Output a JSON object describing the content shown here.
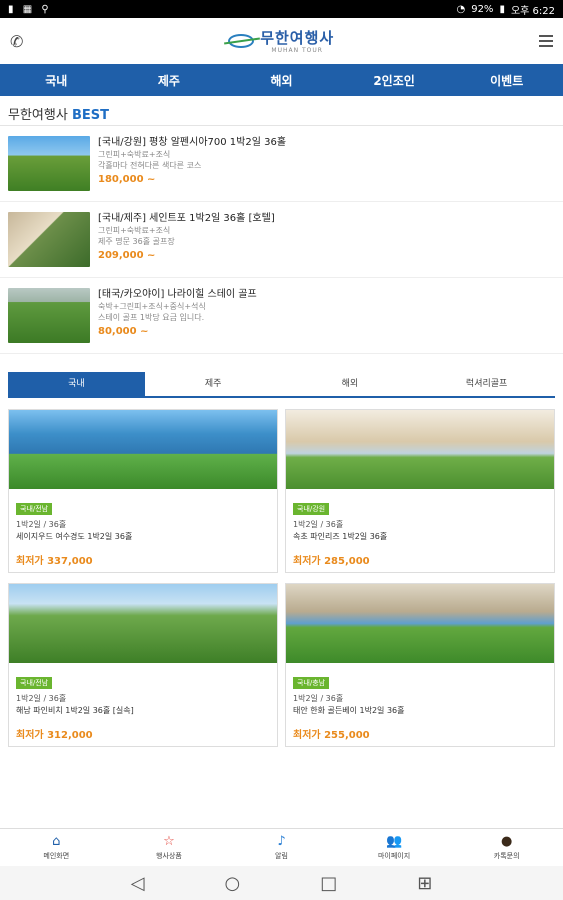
{
  "status": {
    "battery": "92%",
    "time": "오후 6:22"
  },
  "app": {
    "logo_name": "무한여행사",
    "logo_sub": "MUHAN TOUR"
  },
  "nav": [
    "국내",
    "제주",
    "해외",
    "2인조인",
    "이벤트"
  ],
  "best": {
    "prefix": "무한여행사",
    "accent": "BEST",
    "items": [
      {
        "title": "[국내/강원] 평창 알펜시아700 1박2일 36홀",
        "sub1": "그린피+숙박료+조식",
        "sub2": "각홀마다 전혀다른 색다른 코스",
        "price": "180,000 ~"
      },
      {
        "title": "[국내/제주] 세인트포 1박2일 36홀 [호텔]",
        "sub1": "그린피+숙박료+조식",
        "sub2": "제주 명문 36홀 골프장",
        "price": "209,000 ~"
      },
      {
        "title": "[태국/카오야이] 나라이힐 스테이 골프",
        "sub1": "숙박+그린피+조식+중식+석식",
        "sub2": "스테이 골프 1박당 요금 입니다.",
        "price": "80,000 ~"
      }
    ]
  },
  "tabs": [
    "국내",
    "제주",
    "해외",
    "럭셔리골프"
  ],
  "cards": [
    {
      "badge": "국내/전남",
      "meta": "1박2일 / 36홀",
      "title": "세이지우드 여수경도 1박2일 36홀",
      "price": "최저가 337,000"
    },
    {
      "badge": "국내/강원",
      "meta": "1박2일 / 36홀",
      "title": "속초 파인리즈 1박2일 36홀",
      "price": "최저가 285,000"
    },
    {
      "badge": "국내/전남",
      "meta": "1박2일 / 36홀",
      "title": "해남 파인비치 1박2일 36홀 [실속]",
      "price": "최저가 312,000"
    },
    {
      "badge": "국내/충남",
      "meta": "1박2일 / 36홀",
      "title": "태안 한화 골든베이 1박2일 36홀",
      "price": "최저가 255,000"
    }
  ],
  "bottom_nav": [
    {
      "label": "메인화면",
      "icon": "home-icon"
    },
    {
      "label": "행사상품",
      "icon": "star-icon"
    },
    {
      "label": "알림",
      "icon": "bell-icon"
    },
    {
      "label": "마이페이지",
      "icon": "people-icon"
    },
    {
      "label": "카톡문의",
      "icon": "chat-icon"
    }
  ]
}
